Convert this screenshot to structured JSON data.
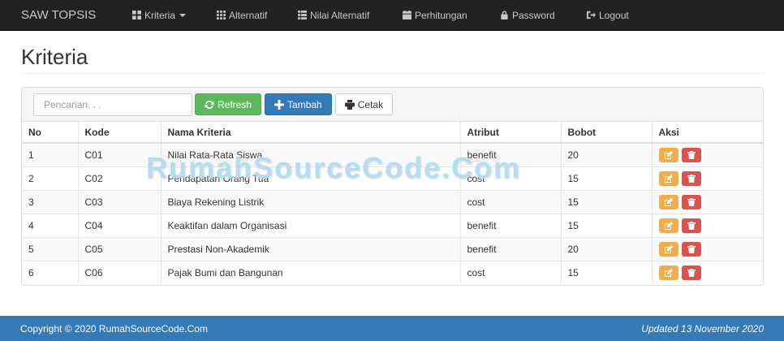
{
  "navbar": {
    "brand": "SAW TOPSIS",
    "items": [
      {
        "label": "Kriteria",
        "icon": "grid-icon",
        "dropdown": true
      },
      {
        "label": "Alternatif",
        "icon": "th-icon"
      },
      {
        "label": "Nilai Alternatif",
        "icon": "list-icon"
      },
      {
        "label": "Perhitungan",
        "icon": "calendar-icon"
      },
      {
        "label": "Password",
        "icon": "lock-icon"
      },
      {
        "label": "Logout",
        "icon": "logout-icon"
      }
    ]
  },
  "page": {
    "title": "Kriteria"
  },
  "toolbar": {
    "search_placeholder": "Pencarian. . .",
    "refresh_label": "Refresh",
    "add_label": "Tambah",
    "print_label": "Cetak"
  },
  "table": {
    "headers": [
      "No",
      "Kode",
      "Nama Kriteria",
      "Atribut",
      "Bobot",
      "Aksi"
    ],
    "rows": [
      {
        "no": "1",
        "kode": "C01",
        "nama": "Nilai Rata-Rata Siswa",
        "atribut": "benefit",
        "bobot": "20"
      },
      {
        "no": "2",
        "kode": "C02",
        "nama": "Pendapatan Orang Tua",
        "atribut": "cost",
        "bobot": "15"
      },
      {
        "no": "3",
        "kode": "C03",
        "nama": "Biaya Rekening Listrik",
        "atribut": "cost",
        "bobot": "15"
      },
      {
        "no": "4",
        "kode": "C04",
        "nama": "Keaktifan dalam Organisasi",
        "atribut": "benefit",
        "bobot": "15"
      },
      {
        "no": "5",
        "kode": "C05",
        "nama": "Prestasi Non-Akademik",
        "atribut": "benefit",
        "bobot": "20"
      },
      {
        "no": "6",
        "kode": "C06",
        "nama": "Pajak Bumi dan Bangunan",
        "atribut": "cost",
        "bobot": "15"
      }
    ]
  },
  "watermark": "RumahSourceCode.Com",
  "footer": {
    "copyright": "Copyright © 2020 RumahSourceCode.Com",
    "updated": "Updated 13 November 2020"
  },
  "colors": {
    "navbar": "#222222",
    "refresh": "#5cb85c",
    "add": "#337ab7",
    "edit": "#f0ad4e",
    "delete": "#d9534f",
    "footer": "#337ab7"
  }
}
